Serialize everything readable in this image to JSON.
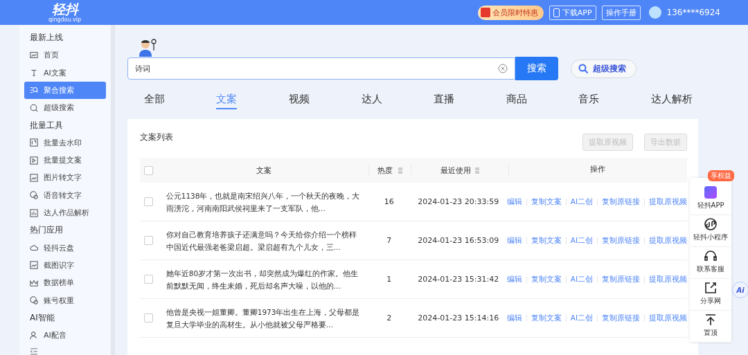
{
  "header": {
    "logo": "轻抖",
    "domain": "qingdou.vip",
    "promo": "会员限时特惠",
    "download": "下载APP",
    "manual": "操作手册",
    "user": "136****6924"
  },
  "sidebar": {
    "groups": [
      {
        "title": "最新上线",
        "items": [
          {
            "label": "首页",
            "selected": false
          },
          {
            "label": "AI文案",
            "selected": false
          },
          {
            "label": "聚合搜索",
            "selected": true
          },
          {
            "label": "超级搜索",
            "selected": false
          }
        ]
      },
      {
        "title": "批量工具",
        "items": [
          {
            "label": "批量去水印",
            "selected": false
          },
          {
            "label": "批量提文案",
            "selected": false
          },
          {
            "label": "图片转文字",
            "selected": false
          },
          {
            "label": "语音转文字",
            "selected": false
          },
          {
            "label": "达人作品解析",
            "selected": false
          }
        ]
      },
      {
        "title": "热门应用",
        "items": [
          {
            "label": "轻抖云盘",
            "selected": false
          },
          {
            "label": "截图识字",
            "selected": false
          },
          {
            "label": "数据榜单",
            "selected": false
          },
          {
            "label": "账号权重",
            "selected": false
          }
        ]
      },
      {
        "title": "AI智能",
        "items": [
          {
            "label": "AI配音",
            "selected": false
          }
        ]
      }
    ]
  },
  "search": {
    "value": "诗词",
    "button": "搜索",
    "super": "超级搜索"
  },
  "tabs": [
    {
      "label": "全部",
      "selected": false
    },
    {
      "label": "文案",
      "selected": true
    },
    {
      "label": "视频",
      "selected": false
    },
    {
      "label": "达人",
      "selected": false
    },
    {
      "label": "直播",
      "selected": false
    },
    {
      "label": "商品",
      "selected": false
    },
    {
      "label": "音乐",
      "selected": false
    },
    {
      "label": "达人解析",
      "selected": false
    }
  ],
  "list": {
    "title": "文案列表",
    "buttons": [
      {
        "label": "提取原视频",
        "disabled": true
      },
      {
        "label": "导出数据",
        "disabled": true
      }
    ],
    "select_all": {
      "checked": false
    },
    "columns": [
      "文案",
      "热度",
      "最近使用",
      "操作"
    ],
    "rows": [
      {
        "checked": false,
        "text": "公元1138年，也就是南宋绍兴八年，一个秋天的夜晚，大雨滂沱，河南南阳武侯祠里来了一支军队，他...",
        "heat": "16",
        "time": "2024-01-23 20:33:59",
        "actions": [
          "编辑",
          "复制文案",
          "AI二创",
          "复制原链接",
          "提取原视频"
        ]
      },
      {
        "checked": false,
        "text": "你对自己教育培养孩子还满意吗？今天给你介绍一个榜样中国近代最强老爸梁启超。梁启超有九个儿女，三...",
        "heat": "7",
        "time": "2024-01-23 16:53:09",
        "actions": [
          "编辑",
          "复制文案",
          "AI二创",
          "复制原链接",
          "提取原视频"
        ]
      },
      {
        "checked": false,
        "text": "她年近80岁才第一次出书，却突然成为爆红的作家。他生前默默无闻，终生未婚，死后却名声大噪，以他的...",
        "heat": "1",
        "time": "2024-01-23 15:31:42",
        "actions": [
          "编辑",
          "复制文案",
          "AI二创",
          "复制原链接",
          "提取原视频"
        ]
      },
      {
        "checked": false,
        "text": "他曾是央视一姐董卿。董卿1973年出生在上海，父母都是复旦大学毕业的高材生。从小他就被父母严格要...",
        "heat": "2",
        "time": "2024-01-23 15:14:16",
        "actions": [
          "编辑",
          "复制文案",
          "AI二创",
          "复制原链接",
          "提取原视频"
        ]
      }
    ]
  },
  "float": {
    "badge": "享权益",
    "items": [
      {
        "label": "轻抖APP"
      },
      {
        "label": "轻抖小程序"
      },
      {
        "label": "联系客服"
      },
      {
        "label": "分享网"
      },
      {
        "label": "置顶"
      }
    ],
    "ai": "Ai"
  }
}
